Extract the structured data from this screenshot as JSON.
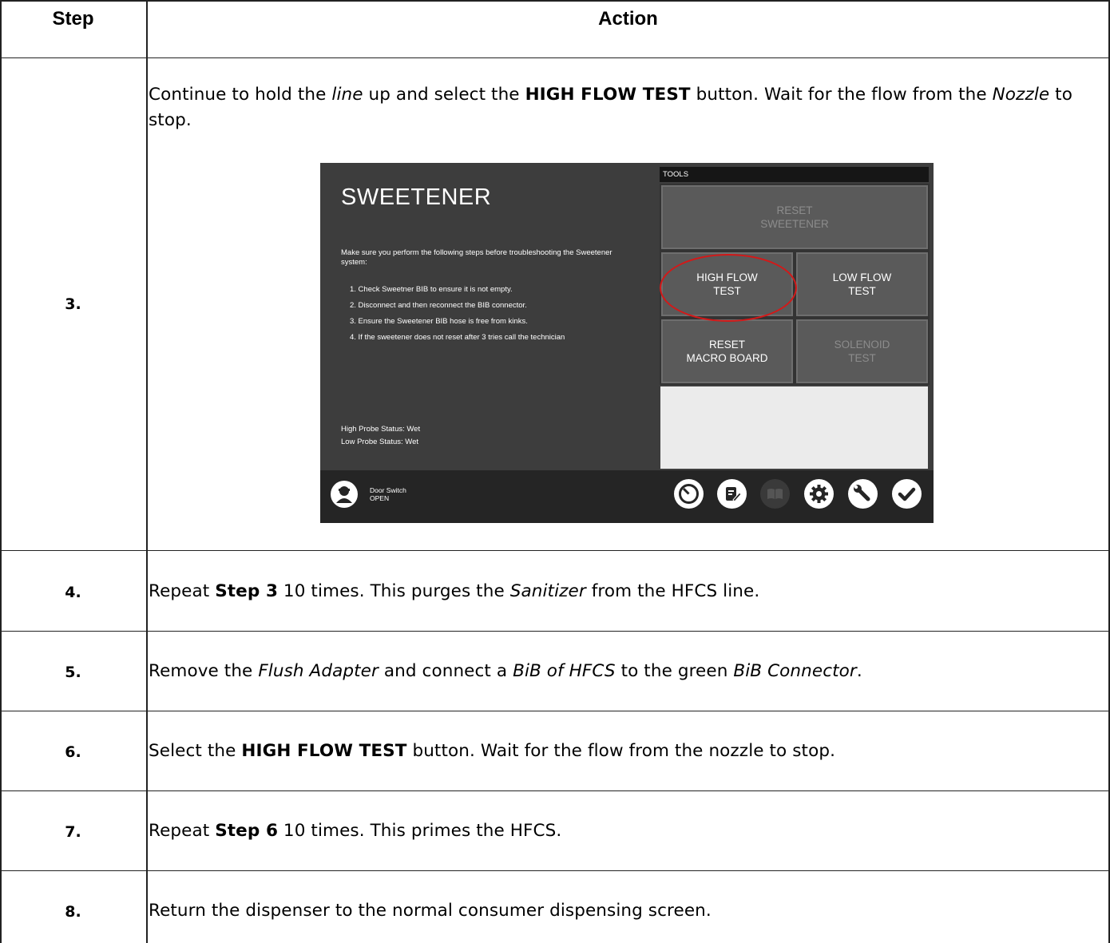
{
  "table": {
    "header_step": "Step",
    "header_action": "Action"
  },
  "rows": [
    {
      "step": "3.",
      "parts": [
        {
          "t": "Continue to hold the "
        },
        {
          "t": "line",
          "s": "i"
        },
        {
          "t": " up and select the "
        },
        {
          "t": "HIGH FLOW TEST",
          "s": "b"
        },
        {
          "t": " button.  Wait for the flow from the "
        },
        {
          "t": "Nozzle",
          "s": "i"
        },
        {
          "t": " to stop."
        }
      ]
    },
    {
      "step": "4.",
      "parts": [
        {
          "t": "Repeat "
        },
        {
          "t": "Step 3",
          "s": "b"
        },
        {
          "t": " 10 times.  This purges the "
        },
        {
          "t": "Sanitizer",
          "s": "i"
        },
        {
          "t": " from the HFCS line."
        }
      ]
    },
    {
      "step": "5.",
      "parts": [
        {
          "t": "Remove the "
        },
        {
          "t": "Flush Adapter",
          "s": "i"
        },
        {
          "t": " and connect a "
        },
        {
          "t": "BiB of HFCS",
          "s": "i"
        },
        {
          "t": " to the green "
        },
        {
          "t": "BiB Connector",
          "s": "i"
        },
        {
          "t": "."
        }
      ]
    },
    {
      "step": "6.",
      "parts": [
        {
          "t": "Select the "
        },
        {
          "t": "HIGH FLOW TEST",
          "s": "b"
        },
        {
          "t": " button.  Wait for the flow from the nozzle to stop."
        }
      ]
    },
    {
      "step": "7.",
      "parts": [
        {
          "t": "Repeat "
        },
        {
          "t": "Step 6",
          "s": "b"
        },
        {
          "t": " 10 times.  This primes the HFCS."
        }
      ]
    },
    {
      "step": "8.",
      "parts": [
        {
          "t": "Return the dispenser to the normal consumer dispensing screen."
        }
      ]
    }
  ],
  "screen": {
    "title": "SWEETENER",
    "intro": "Make sure you perform the following steps before troubleshooting the Sweetener system:",
    "steps": [
      "1.  Check Sweetner BIB to ensure it is not empty.",
      "2.  Disconnect and then reconnect the BIB connector.",
      "3.  Ensure the Sweetener BIB hose is free from kinks.",
      "4.  If the sweetener does not reset after 3 tries call the technician"
    ],
    "high_probe": "High Probe Status:   Wet",
    "low_probe": "Low Probe Status:   Wet",
    "tools_label": "TOOLS",
    "tiles": {
      "reset_sweetener": "RESET\nSWEETENER",
      "high_flow": "HIGH FLOW\nTEST",
      "low_flow": "LOW FLOW\nTEST",
      "reset_macro": "RESET\nMACRO BOARD",
      "solenoid": "SOLENOID\nTEST"
    },
    "door_label": "Door Switch",
    "door_state": "OPEN",
    "icons": [
      "gauge-icon",
      "edit-note-icon",
      "book-icon",
      "gear-icon",
      "wrench-icon",
      "checkmark-icon"
    ]
  }
}
